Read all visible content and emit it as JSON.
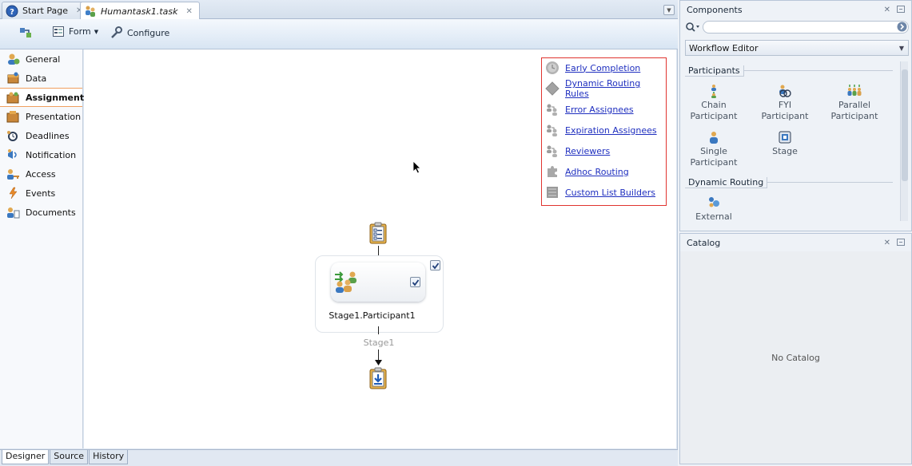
{
  "tabs": [
    {
      "label": "Start Page",
      "icon": "help-icon"
    },
    {
      "label": "Humantask1.task",
      "icon": "task-icon"
    }
  ],
  "toolbar": {
    "form_label": "Form",
    "configure_label": "Configure"
  },
  "sidenav": {
    "items": [
      {
        "label": "General",
        "icon": "general-icon"
      },
      {
        "label": "Data",
        "icon": "data-icon"
      },
      {
        "label": "Assignment",
        "icon": "assignment-icon"
      },
      {
        "label": "Presentation",
        "icon": "presentation-icon"
      },
      {
        "label": "Deadlines",
        "icon": "deadlines-icon"
      },
      {
        "label": "Notification",
        "icon": "notification-icon"
      },
      {
        "label": "Access",
        "icon": "access-icon"
      },
      {
        "label": "Events",
        "icon": "events-icon"
      },
      {
        "label": "Documents",
        "icon": "documents-icon"
      }
    ],
    "active_index": 2
  },
  "legend": {
    "items": [
      {
        "label": "Early Completion",
        "icon": "clock-icon"
      },
      {
        "label": "Dynamic Routing Rules",
        "icon": "diamond-icon"
      },
      {
        "label": "Error Assignees",
        "icon": "assignees-icon"
      },
      {
        "label": "Expiration Assignees",
        "icon": "assignees-icon"
      },
      {
        "label": "Reviewers",
        "icon": "assignees-icon"
      },
      {
        "label": "Adhoc Routing",
        "icon": "puzzle-icon"
      },
      {
        "label": "Custom List Builders",
        "icon": "list-builder-icon"
      }
    ],
    "border_color": "#e0342f"
  },
  "flow": {
    "participant_label": "Stage1.Participant1",
    "stage_label": "Stage1"
  },
  "bottom_tabs": [
    "Designer",
    "Source",
    "History"
  ],
  "components_panel": {
    "title": "Components",
    "palette": "Workflow Editor",
    "groups": [
      {
        "label": "Participants",
        "items": [
          {
            "label": "Chain Participant",
            "line1": "Chain",
            "line2": "Participant",
            "icon": "chain-participant-icon"
          },
          {
            "label": "FYI Participant",
            "line1": "FYI",
            "line2": "Participant",
            "icon": "fyi-participant-icon"
          },
          {
            "label": "Parallel Participant",
            "line1": "Parallel",
            "line2": "Participant",
            "icon": "parallel-participant-icon"
          },
          {
            "label": "Single Participant",
            "line1": "Single",
            "line2": "Participant",
            "icon": "single-participant-icon"
          },
          {
            "label": "Stage",
            "line1": "Stage",
            "line2": "",
            "icon": "stage-icon"
          }
        ]
      },
      {
        "label": "Dynamic Routing",
        "items": [
          {
            "label": "External",
            "line1": "External",
            "line2": "",
            "icon": "external-icon"
          }
        ]
      }
    ]
  },
  "catalog_panel": {
    "title": "Catalog",
    "empty_text": "No Catalog"
  },
  "colors": {
    "accent": "#f0a060",
    "link": "#1f2fbf",
    "toolbar_bg": "#d8e5f3"
  }
}
